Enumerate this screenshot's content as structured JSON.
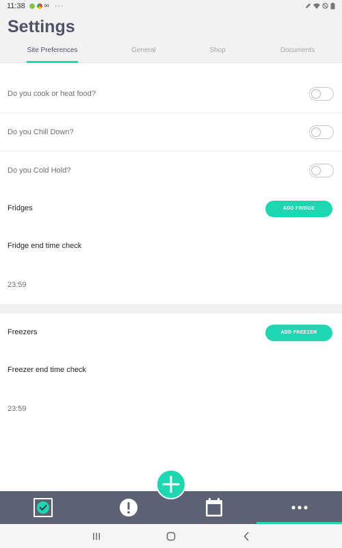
{
  "status_bar": {
    "time": "11:38",
    "more": "···"
  },
  "header": {
    "title": "Settings",
    "tabs": [
      {
        "label": "Site Preferences",
        "active": true
      },
      {
        "label": "General",
        "active": false
      },
      {
        "label": "Shop",
        "active": false
      },
      {
        "label": "Documents",
        "active": false
      }
    ]
  },
  "preferences": [
    {
      "label": "Do you cook or heat food?",
      "enabled": false
    },
    {
      "label": "Do you Chill Down?",
      "enabled": false
    },
    {
      "label": "Do you Cold Hold?",
      "enabled": false
    }
  ],
  "fridges": {
    "title": "Fridges",
    "add_label": "ADD FRIDGE",
    "end_check_label": "Fridge end time check",
    "end_time": "23:59"
  },
  "freezers": {
    "title": "Freezers",
    "add_label": "ADD FREEZER",
    "end_check_label": "Freezer end time check",
    "end_time": "23:59"
  },
  "bottom_nav": {
    "items": [
      {
        "icon": "checklist-icon"
      },
      {
        "icon": "alert-icon"
      },
      {
        "icon": "calendar-icon"
      },
      {
        "icon": "more-icon",
        "active": true
      }
    ],
    "accent": "#1ed6b0",
    "background": "#5c6273"
  },
  "fab": {
    "icon": "plus-icon"
  },
  "theme": {
    "accent": "#1ed6b0",
    "title_color": "#4f5268"
  }
}
